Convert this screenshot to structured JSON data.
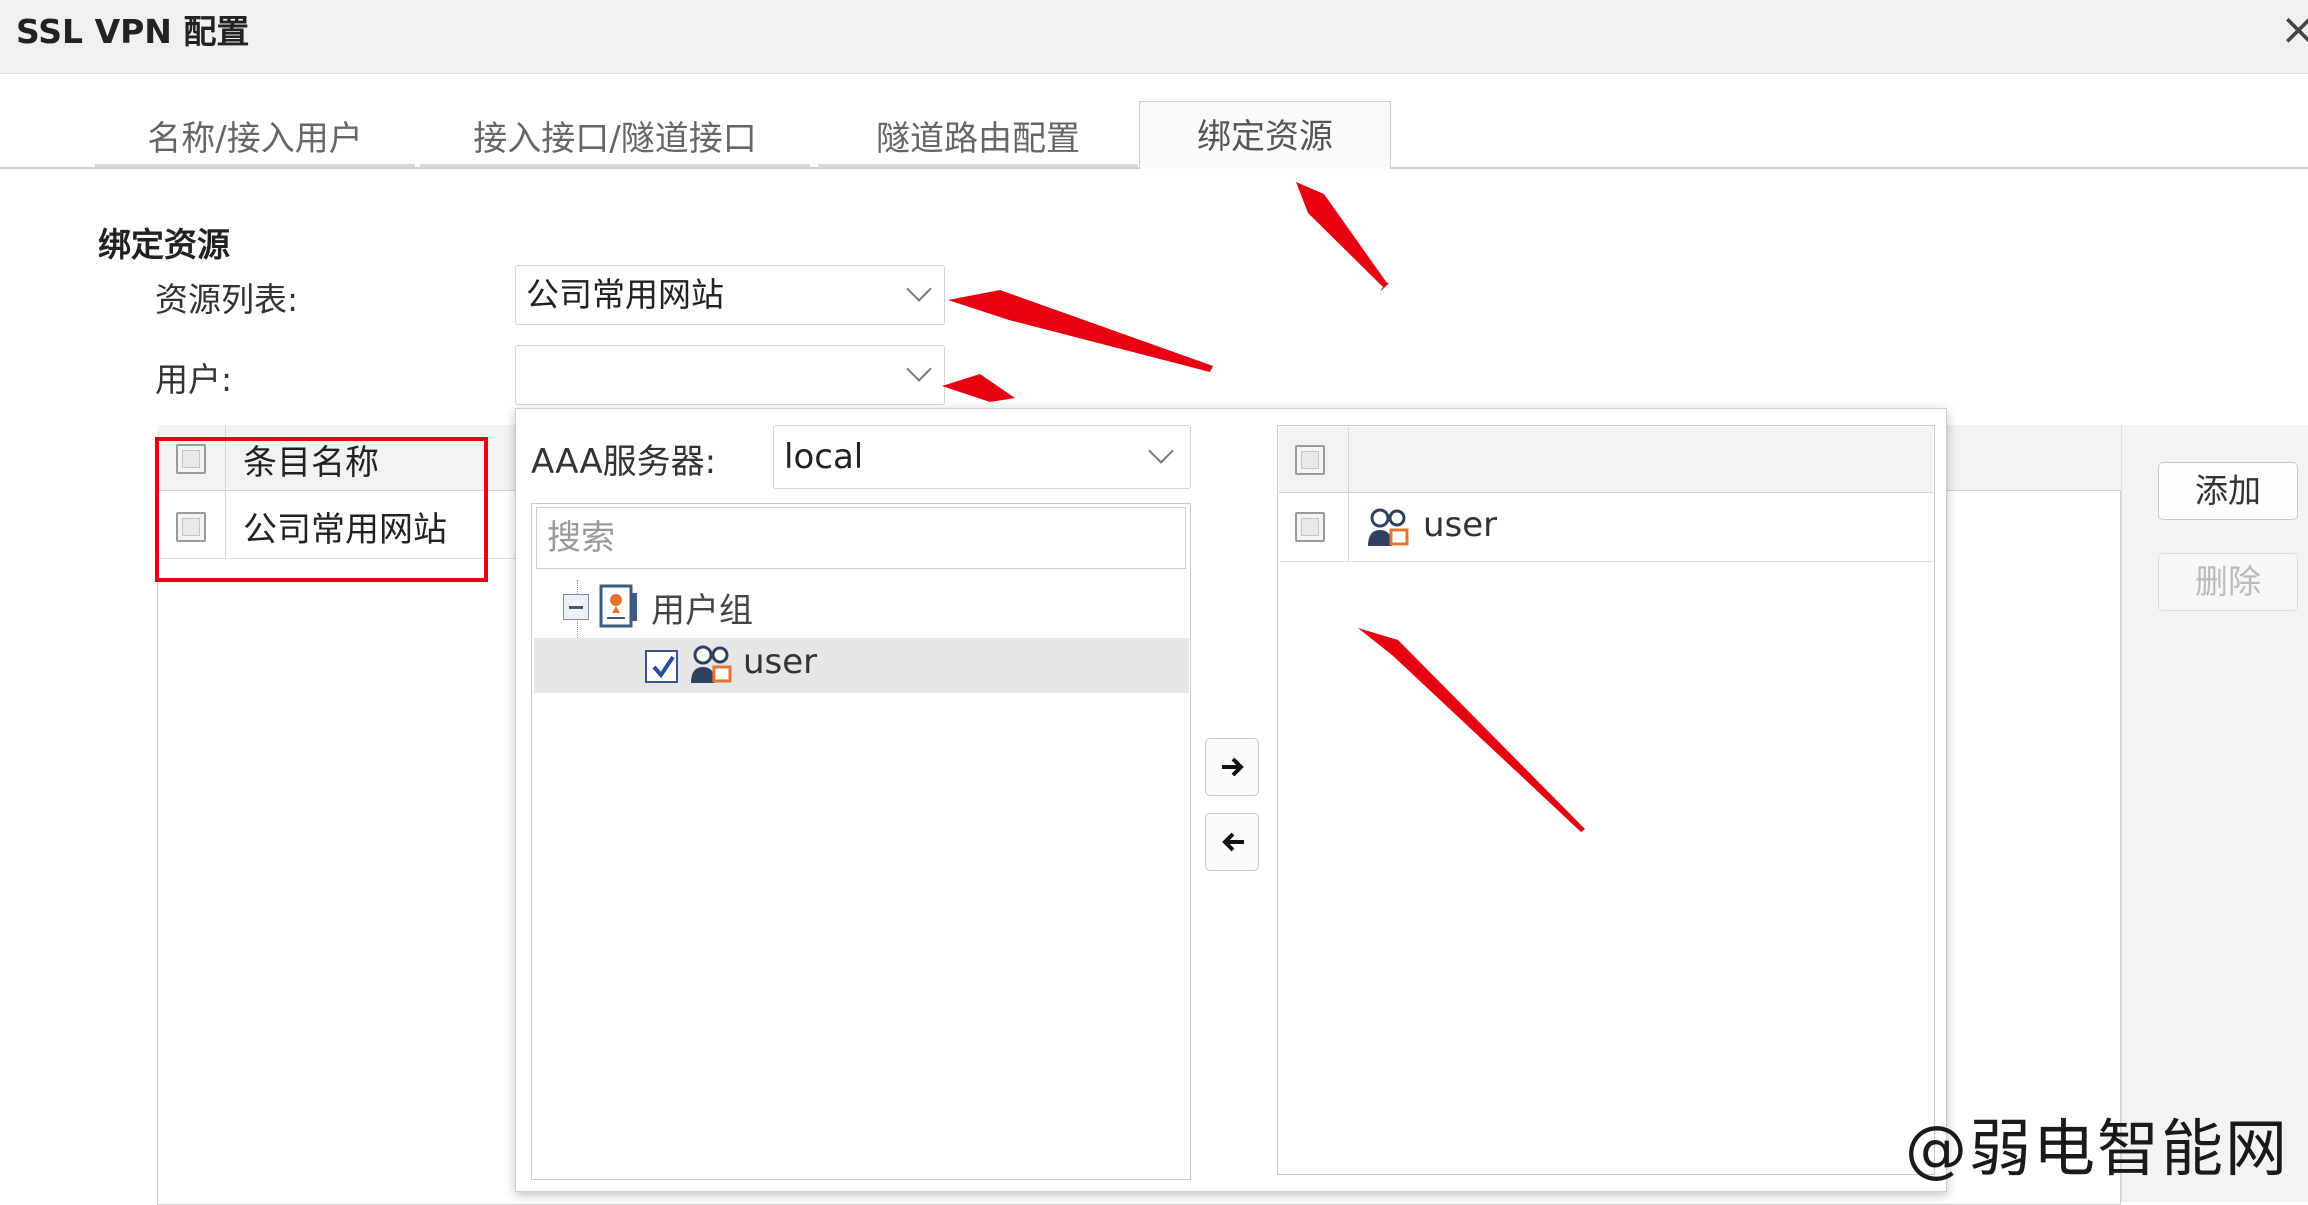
{
  "window": {
    "title": "SSL VPN 配置",
    "close_glyph": "×"
  },
  "tabs": [
    {
      "label": "名称/接入用户",
      "active": false
    },
    {
      "label": "接入接口/隧道接口",
      "active": false
    },
    {
      "label": "隧道路由配置",
      "active": false
    },
    {
      "label": "绑定资源",
      "active": true
    }
  ],
  "section": {
    "title": "绑定资源",
    "resource_label": "资源列表:",
    "resource_value": "公司常用网站",
    "user_label": "用户:",
    "user_value": ""
  },
  "grid": {
    "header": "条目名称",
    "rows": [
      {
        "name": "公司常用网站"
      }
    ]
  },
  "side_buttons": {
    "add": "添加",
    "delete": "删除"
  },
  "popup": {
    "aaa_label": "AAA服务器:",
    "aaa_value": "local",
    "search_placeholder": "搜索",
    "tree": {
      "group_label": "用户组",
      "child_label": "user",
      "child_checked": true
    },
    "selected_list": [
      {
        "label": "user"
      }
    ]
  },
  "colors": {
    "annotation_red": "#e60012",
    "tab_bg": "#fafafa"
  },
  "icons": [
    "close-icon",
    "chevron-down-icon",
    "collapse-icon",
    "user-group-icon",
    "user-icon",
    "arrow-right-icon",
    "arrow-left-icon"
  ],
  "watermark": "@弱电智能网"
}
